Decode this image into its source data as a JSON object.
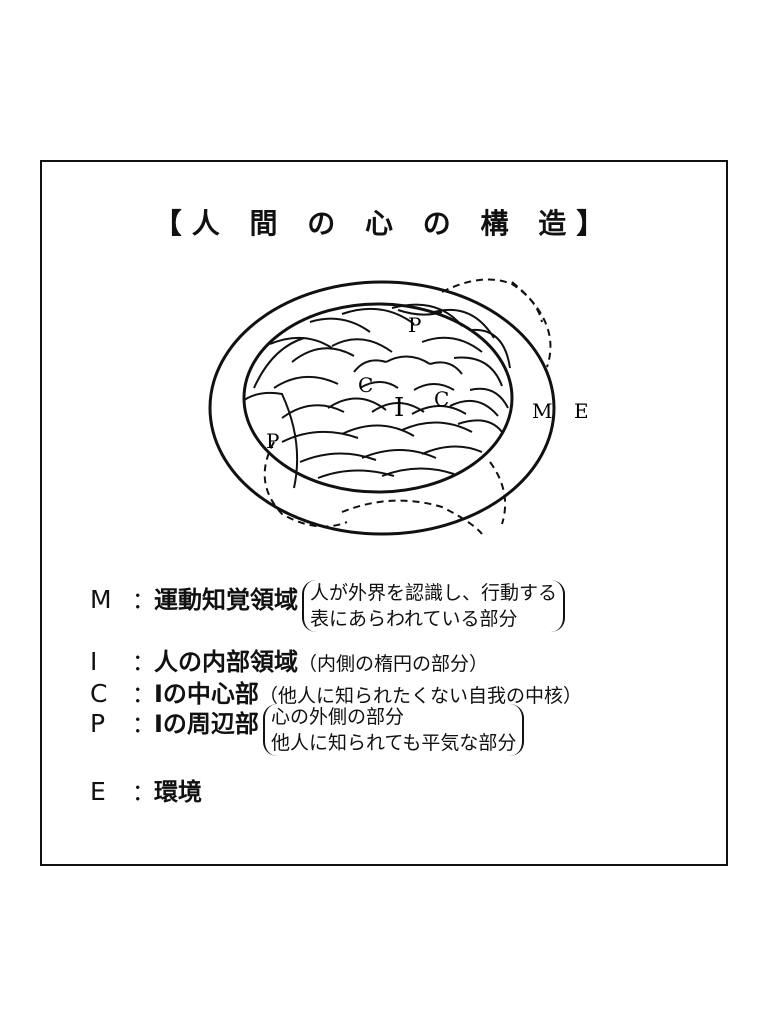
{
  "title": "【人 間 の 心 の 構 造】",
  "diagram_labels": {
    "p_top": "P",
    "c_left": "C",
    "i_center": "I",
    "c_right": "C",
    "p_left": "P",
    "m": "M",
    "e": "E"
  },
  "legend": {
    "m": {
      "key": "M",
      "colon": "：",
      "term": "運動知覚領域",
      "desc_line1": "人が外界を認識し、行動する",
      "desc_line2": "表にあらわれている部分"
    },
    "i": {
      "key": "I",
      "colon": "：",
      "term": "人の内部領域",
      "desc": "（内側の楕円の部分）"
    },
    "c": {
      "key": "C",
      "colon": "：",
      "term": "Iの中心部",
      "desc": "（他人に知られたくない自我の中核）"
    },
    "p": {
      "key": "P",
      "colon": "：",
      "term": "Iの周辺部",
      "desc_line1": "心の外側の部分",
      "desc_line2": "他人に知られても平気な部分"
    },
    "e": {
      "key": "E",
      "colon": "：",
      "term": "環境"
    }
  }
}
